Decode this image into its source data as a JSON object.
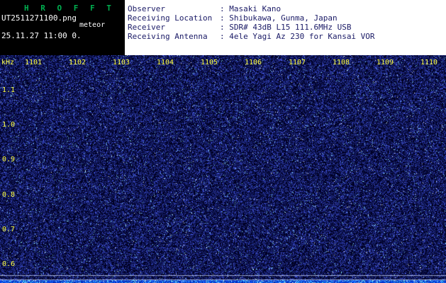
{
  "header": {
    "logo": "H R O F F T",
    "filename": "UT2511271100.png",
    "station": "meteor",
    "datetime": "25.11.27 11:00  0.",
    "separator": ": ",
    "info_rows": [
      {
        "label": "Observer",
        "value": "Masaki Kano"
      },
      {
        "label": "Receiving Location",
        "value": "Shibukawa, Gunma, Japan"
      },
      {
        "label": "Receiver",
        "value": "SDR# 43dB L15 111.6MHz USB"
      },
      {
        "label": "Receiving Antenna",
        "value": "4ele Yagi Az 230 for Kansai VOR"
      }
    ]
  },
  "spectrogram": {
    "unit_label": "kHz",
    "time_labels": [
      "1101",
      "1102",
      "1103",
      "1104",
      "1105",
      "1106",
      "1107",
      "1108",
      "1109",
      "1110"
    ],
    "freq_labels": [
      "1.1",
      "1.0",
      "0.9",
      "0.8",
      "0.7",
      "0.6"
    ]
  },
  "colors": {
    "logo_green": "#00b050",
    "header_bg_left": "#000000",
    "header_bg_right": "#ffffff",
    "header_text": "#1a1a66",
    "label_yellow": "#ffff44",
    "spec_background": "#000024",
    "speckle_dim": "#16206a",
    "speckle_mid": "#27359e",
    "speckle_bright": "#4a5ce8",
    "speckle_cyan": "#7fd4ff",
    "speckle_white": "#e0f2ff",
    "gridline": "#9aa4cc",
    "band_dark": "#0428b4",
    "band_base": "#0a46e6",
    "band_mid": "#1e6eff",
    "band_cyan": "#46d2ff",
    "band_white": "#c8f0ff"
  }
}
